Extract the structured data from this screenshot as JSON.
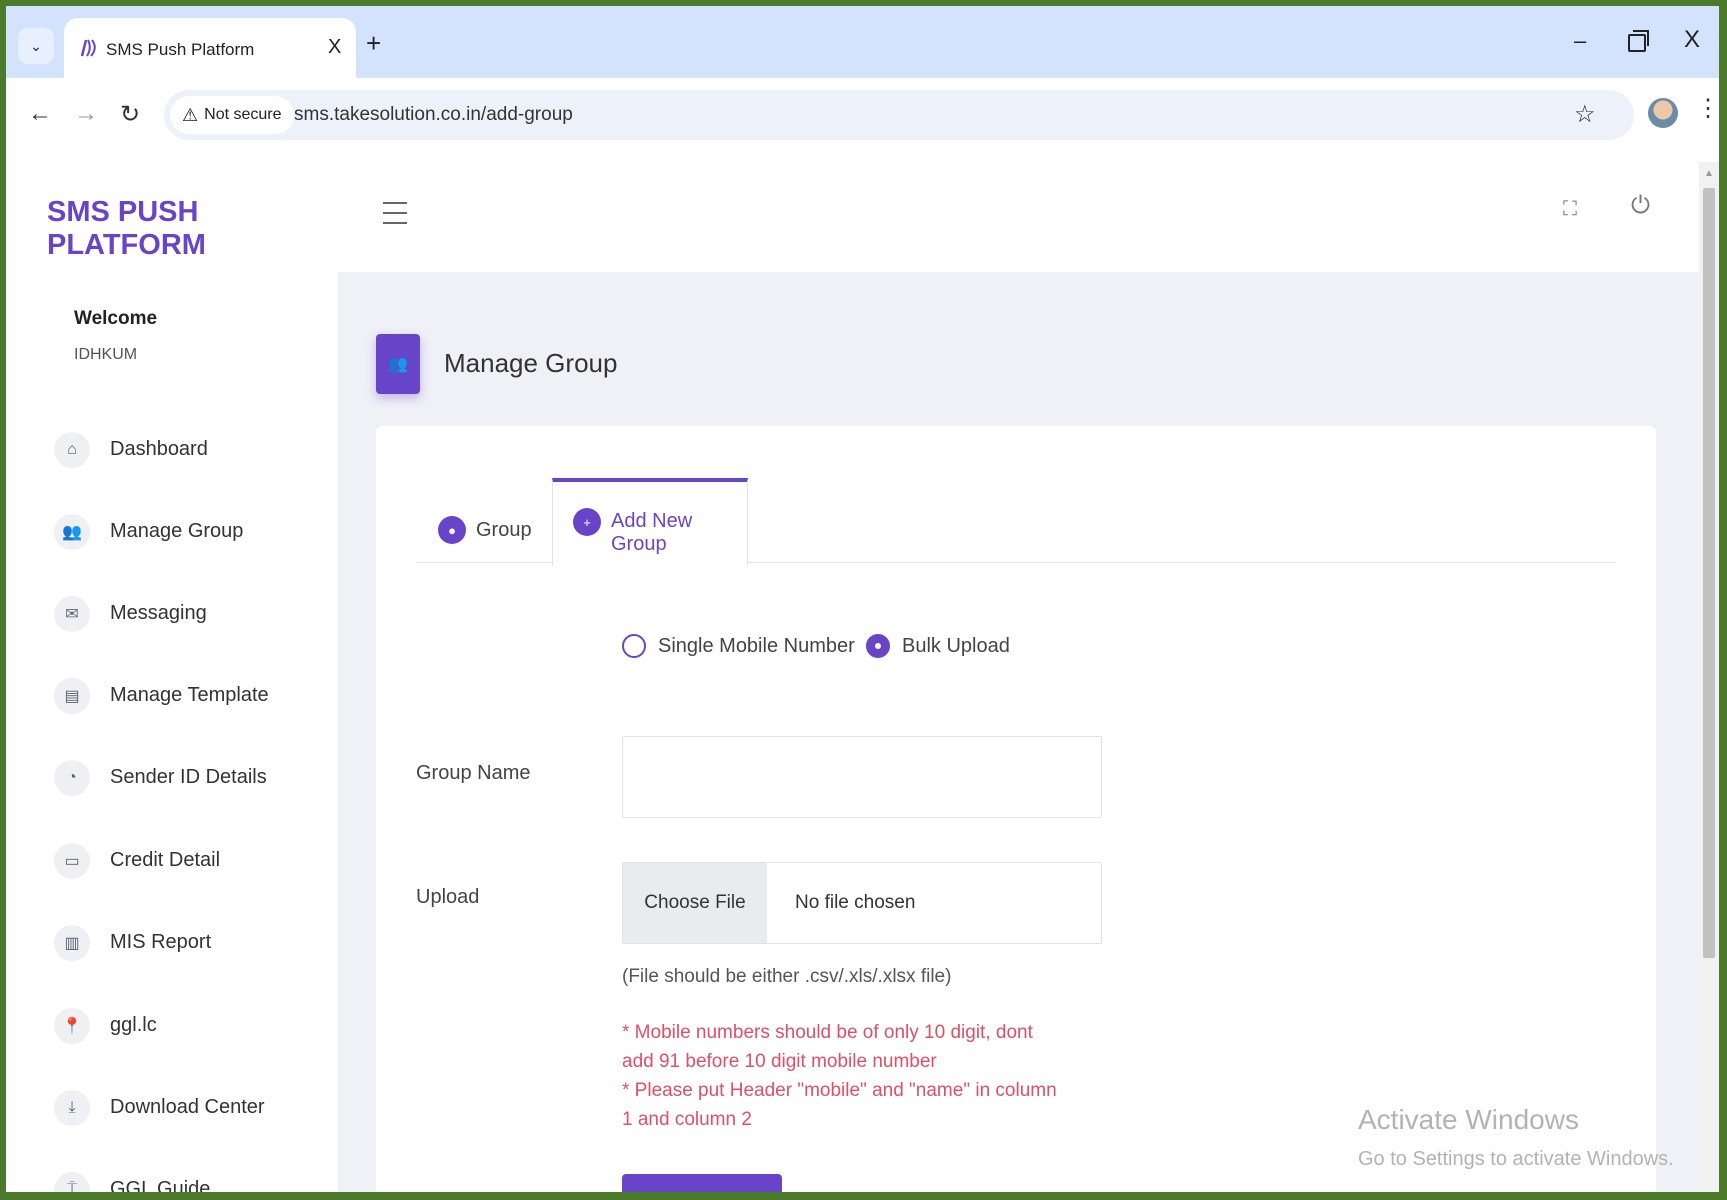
{
  "browser": {
    "tab_title": "SMS Push Platform",
    "tab_close": "X",
    "new_tab": "+",
    "security_label": "Not secure",
    "url": "sms.takesolution.co.in/add-group",
    "window_min": "–",
    "window_close": "X"
  },
  "app": {
    "logo": "SMS PUSH PLATFORM",
    "welcome_label": "Welcome",
    "username": "IDHKUM"
  },
  "sidebar": {
    "items": [
      {
        "label": "Dashboard",
        "icon": "home-icon"
      },
      {
        "label": "Manage Group",
        "icon": "users-icon"
      },
      {
        "label": "Messaging",
        "icon": "envelope-icon"
      },
      {
        "label": "Manage Template",
        "icon": "document-icon"
      },
      {
        "label": "Sender ID Details",
        "icon": "badge-icon"
      },
      {
        "label": "Credit Detail",
        "icon": "credit-card-icon"
      },
      {
        "label": "MIS Report",
        "icon": "bar-chart-icon"
      },
      {
        "label": "ggl.lc",
        "icon": "pin-icon"
      },
      {
        "label": "Download Center",
        "icon": "download-icon"
      },
      {
        "label": "GGL Guide",
        "icon": "paint-roller-icon"
      }
    ]
  },
  "page": {
    "title": "Manage Group",
    "tabs": [
      {
        "label": "Group",
        "active": false
      },
      {
        "label": "Add New Group",
        "active": true
      }
    ],
    "radio_options": [
      {
        "label": "Single Mobile Number",
        "checked": false
      },
      {
        "label": "Bulk Upload",
        "checked": true
      }
    ],
    "group_name_label": "Group Name",
    "group_name_value": "",
    "upload_label": "Upload",
    "file_button": "Choose File",
    "file_status": "No file chosen",
    "file_hint": "(File should be either .csv/.xls/.xlsx file)",
    "warning_1": "* Mobile numbers should be of only 10 digit, dont add 91 before 10 digit mobile number",
    "warning_2": "* Please put Header \"mobile\" and \"name\" in column 1 and column 2"
  },
  "watermark": {
    "title": "Activate Windows",
    "subtitle": "Go to Settings to activate Windows."
  },
  "colors": {
    "accent": "#6845c8",
    "warning": "#e04f68",
    "frame_border": "#4a7a2a"
  }
}
